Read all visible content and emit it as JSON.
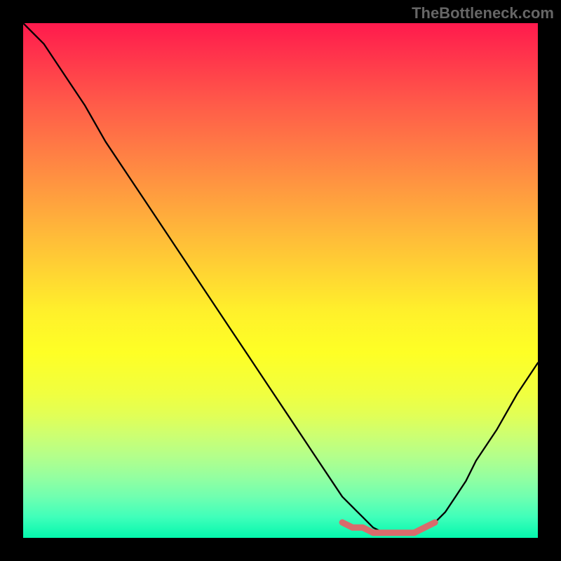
{
  "watermark": "TheBottleneck.com",
  "chart_data": {
    "type": "line",
    "title": "",
    "xlabel": "",
    "ylabel": "",
    "xlim": [
      0,
      100
    ],
    "ylim": [
      0,
      100
    ],
    "series": [
      {
        "name": "main-curve",
        "color": "#000000",
        "x": [
          0,
          4,
          8,
          12,
          16,
          20,
          24,
          28,
          32,
          36,
          40,
          44,
          48,
          52,
          56,
          60,
          62,
          64,
          66,
          68,
          70,
          72,
          74,
          76,
          78,
          80,
          82,
          84,
          86,
          88,
          92,
          96,
          100
        ],
        "values": [
          100,
          96,
          90,
          84,
          77,
          71,
          65,
          59,
          53,
          47,
          41,
          35,
          29,
          23,
          17,
          11,
          8,
          6,
          4,
          2,
          1,
          1,
          1,
          1,
          2,
          3,
          5,
          8,
          11,
          15,
          21,
          28,
          34
        ]
      },
      {
        "name": "flat-highlight",
        "color": "#d96c6c",
        "x": [
          62,
          64,
          66,
          68,
          70,
          72,
          74,
          76,
          78,
          80
        ],
        "values": [
          3,
          2,
          2,
          1,
          1,
          1,
          1,
          1,
          2,
          3
        ]
      }
    ],
    "annotations": []
  }
}
